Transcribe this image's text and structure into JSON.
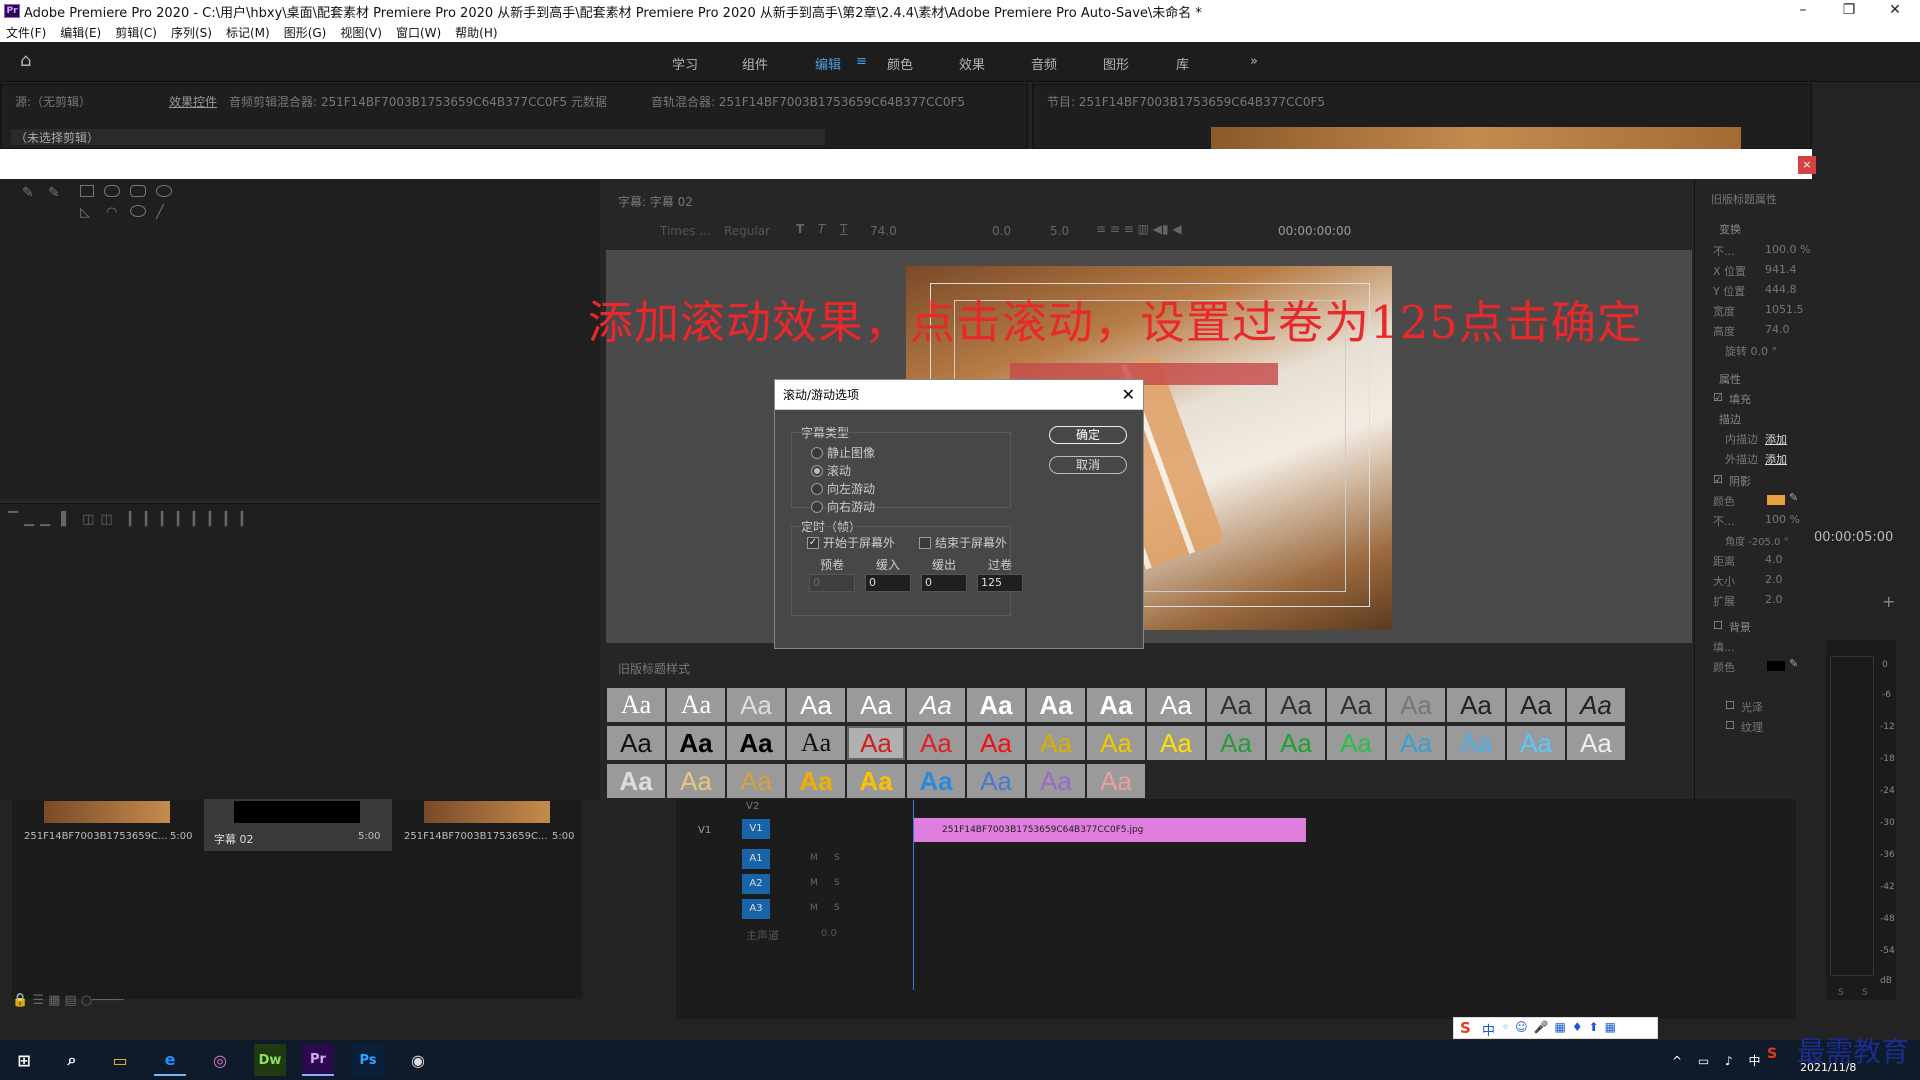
{
  "window": {
    "title": "Adobe Premiere Pro 2020 - C:\\用户\\hbxy\\桌面\\配套素材 Premiere Pro 2020 从新手到高手\\配套素材 Premiere Pro 2020 从新手到高手\\第2章\\2.4.4\\素材\\Adobe Premiere Pro Auto-Save\\未命名 *",
    "app_icon": "Pr"
  },
  "menu": [
    "文件(F)",
    "编辑(E)",
    "剪辑(C)",
    "序列(S)",
    "标记(M)",
    "图形(G)",
    "视图(V)",
    "窗口(W)",
    "帮助(H)"
  ],
  "workspaces": [
    {
      "label": "学习"
    },
    {
      "label": "组件"
    },
    {
      "label": "编辑",
      "active": true
    },
    {
      "label": "颜色"
    },
    {
      "label": "效果"
    },
    {
      "label": "音频"
    },
    {
      "label": "图形"
    },
    {
      "label": "库"
    }
  ],
  "source_panel": {
    "tabs": [
      "源:（无剪辑）",
      "效果控件",
      "音频剪辑混合器: 251F14BF7003B1753659C64B377CC0F5",
      "元数据",
      "音轨混合器: 251F14BF7003B1753659C64B377CC0F5"
    ],
    "no_clip": "（未选择剪辑）"
  },
  "program_panel": {
    "tab": "节目: 251F14BF7003B1753659C64B377CC0F5"
  },
  "titler": {
    "tab": "字幕: 字幕 02",
    "font": "Times ...",
    "style": "Regular",
    "size": "74.0",
    "kerning": "0.0",
    "leading": "5.0",
    "timecode": "00:00:00:00",
    "styles_tab": "旧版标题样式",
    "props_tab": "旧版标题属性",
    "sample": "Aa"
  },
  "overlay_instruction": "添加滚动效果，点击滚动，设置过卷为125点击确定",
  "dialog": {
    "title": "滚动/游动选项",
    "type_label": "字幕类型",
    "types": [
      "静止图像",
      "滚动",
      "向左游动",
      "向右游动"
    ],
    "selected_type": "滚动",
    "timing_label": "定时（帧）",
    "start_offscreen": "开始于屏幕外",
    "end_offscreen": "结束于屏幕外",
    "fields": [
      {
        "label": "预卷",
        "value": "0",
        "disabled": true
      },
      {
        "label": "缓入",
        "value": "0"
      },
      {
        "label": "缓出",
        "value": "0"
      },
      {
        "label": "过卷",
        "value": "125"
      }
    ],
    "ok": "确定",
    "cancel": "取消"
  },
  "properties": {
    "transform": "变换",
    "opacity_label": "不...",
    "opacity": "100.0 %",
    "x_label": "X 位置",
    "x": "941.4",
    "y_label": "Y 位置",
    "y": "444.8",
    "width_label": "宽度",
    "width": "1051.5",
    "height_label": "高度",
    "height": "74.0",
    "rotate": "旋转 0.0 °",
    "attributes": "属性",
    "fill": "填充",
    "stroke": "描边",
    "inner_stroke": "内描边",
    "outer_stroke": "外描边",
    "add": "添加",
    "shadow": "阴影",
    "color": "颜色",
    "shadow_opacity": "100 %",
    "angle": "角度 -205.0 °",
    "distance_label": "距离",
    "distance": "4.0",
    "size_label": "大小",
    "size": "2.0",
    "spread_label": "扩展",
    "spread": "2.0",
    "background": "背景",
    "fill_label": "填...",
    "sheen": "光泽",
    "texture": "纹理",
    "shadow_color": "#e8a13a"
  },
  "program_time": "00:00:05:00",
  "bin": {
    "items": [
      {
        "name": "251F14BF7003B1753659C...",
        "duration": "5:00"
      },
      {
        "name": "字幕 02",
        "duration": "5:00"
      },
      {
        "name": "251F14BF7003B1753659C...",
        "duration": "5:00"
      }
    ]
  },
  "timeline": {
    "tracks": [
      "V2",
      "V1",
      "A1",
      "A2",
      "A3"
    ],
    "source_v1": "V1",
    "clip": "251F14BF7003B1753659C64B377CC0F5.jpg",
    "master": "主声道",
    "master_val": "0.0",
    "mute": "M",
    "solo": "S"
  },
  "meter": {
    "scale": [
      "0",
      "-6",
      "-12",
      "-18",
      "-24",
      "-30",
      "-36",
      "-42",
      "-48",
      "-54",
      "dB"
    ],
    "solo_labels": [
      "S",
      "S"
    ]
  },
  "taskbar": {
    "apps": [
      "⊞",
      "⌕",
      "▭",
      "e",
      "◎",
      "Dw",
      "Pr",
      "Ps",
      "◉"
    ],
    "date": "2021/11/8",
    "tray": "中"
  },
  "watermark": "最需教育",
  "colors": {
    "accent": "#4a9de0",
    "clip": "#e07ee0",
    "overlay_text": "#e8282a"
  }
}
